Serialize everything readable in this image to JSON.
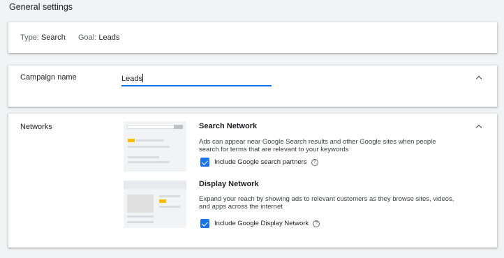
{
  "page": {
    "section_title": "General settings"
  },
  "summary": {
    "type_label": "Type:",
    "type_value": "Search",
    "goal_label": "Goal:",
    "goal_value": "Leads"
  },
  "campaign": {
    "label": "Campaign name",
    "value": "Leads"
  },
  "networks": {
    "label": "Networks",
    "search": {
      "title": "Search Network",
      "description": "Ads can appear near Google Search results and other Google sites when people search for terms that are relevant to your keywords",
      "checkbox_label": "Include Google search partners",
      "checked": true
    },
    "display": {
      "title": "Display Network",
      "description": "Expand your reach by showing ads to relevant customers as they browse sites, videos, and apps across the internet",
      "checkbox_label": "Include Google Display Network",
      "checked": true
    }
  },
  "icons": {
    "collapse": "chevron-up-icon",
    "help": "help-circle-icon"
  },
  "colors": {
    "accent": "#1a73e8",
    "ad_highlight": "#fbbc04"
  }
}
